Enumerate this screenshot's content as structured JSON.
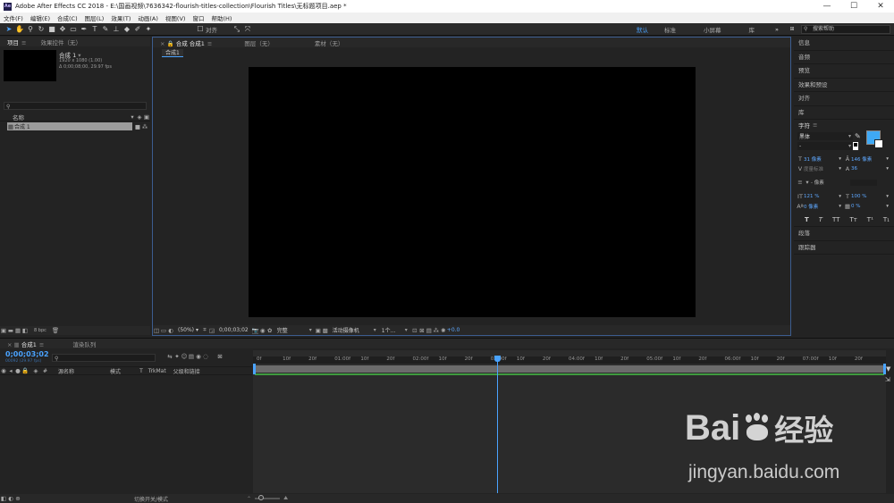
{
  "window": {
    "title": "Adobe After Effects CC 2018 - E:\\国画视频\\7636342-flourish-titles-collection\\Flourish Titles\\无标题项目.aep *",
    "app_icon": "Ae",
    "minimize": "—",
    "maximize": "☐",
    "close": "✕"
  },
  "menu": [
    "文件(F)",
    "编辑(E)",
    "合成(C)",
    "图层(L)",
    "效果(T)",
    "动画(A)",
    "视图(V)",
    "窗口",
    "帮助(H)"
  ],
  "toolbar": {
    "align_label": "对齐",
    "workspaces": [
      "默认",
      "标准",
      "小屏幕",
      "库"
    ],
    "active_workspace": "默认",
    "more": "»",
    "search_placeholder": "搜索帮助"
  },
  "project_panel": {
    "tabs": [
      "项目",
      "效果控件（无）"
    ],
    "item_name": "合成 1",
    "item_dims": "1920 x 1080 (1.00)",
    "item_duration": "Δ 0;00;08;00, 29.97 fps",
    "column_name": "名称",
    "rows": [
      {
        "name": "合成 1"
      }
    ],
    "bpc": "8 bpc"
  },
  "comp_panel": {
    "tabs": [
      "合成 合成1",
      "图层（无）",
      "素材（无）"
    ],
    "sub_tab": "合成1",
    "zoom": "(50%)",
    "timecode": "0;00;03;02",
    "resolution": "完整",
    "camera": "活动摄像机",
    "views": "1个...",
    "exposure": "+0.0"
  },
  "right_panel": {
    "items_top": [
      "信息",
      "音频",
      "预览",
      "效果和预设",
      "对齐",
      "库"
    ],
    "character_title": "字符",
    "font_name": "黑体",
    "font_style": "-",
    "font_size": "31 像素",
    "leading": "146 像素",
    "kerning": "度量标准",
    "tracking": "36",
    "stroke_width": "- 像素",
    "vscale": "121 %",
    "hscale": "100 %",
    "baseline": "0 像素",
    "tsume": "0 %",
    "type_styles": [
      "T",
      "T",
      "TT",
      "Tт",
      "T¹",
      "T₁"
    ],
    "fill_color": "#3fa9f5",
    "items_bottom": [
      "段落",
      "跟踪器"
    ]
  },
  "timeline": {
    "tabs": [
      "合成1",
      "渲染队列"
    ],
    "timecode": "0;00;03;02",
    "timecode_sub": "00092 (29.97 fps)",
    "columns": [
      "源名称",
      "模式",
      "T",
      "TrkMat",
      "父级和链接"
    ],
    "ruler_labels": [
      "0f",
      "10f",
      "20f",
      "01:00f",
      "10f",
      "20f",
      "02:00f",
      "10f",
      "20f",
      "03:00f",
      "10f",
      "20f",
      "04:00f",
      "10f",
      "20f",
      "05:00f",
      "10f",
      "20f",
      "06:00f",
      "10f",
      "20f",
      "07:00f",
      "10f",
      "20f"
    ],
    "playhead_fraction": 0.386,
    "footer_toggle": "切换开关/模式"
  },
  "watermark": {
    "brand": "Bai",
    "brand_tail": "经验",
    "url": "jingyan.baidu.com"
  },
  "colors": {
    "accent": "#4aa3ff",
    "panel_bg": "#232323",
    "viewer_bg": "#000000",
    "work_area": "#3f9b3f"
  }
}
